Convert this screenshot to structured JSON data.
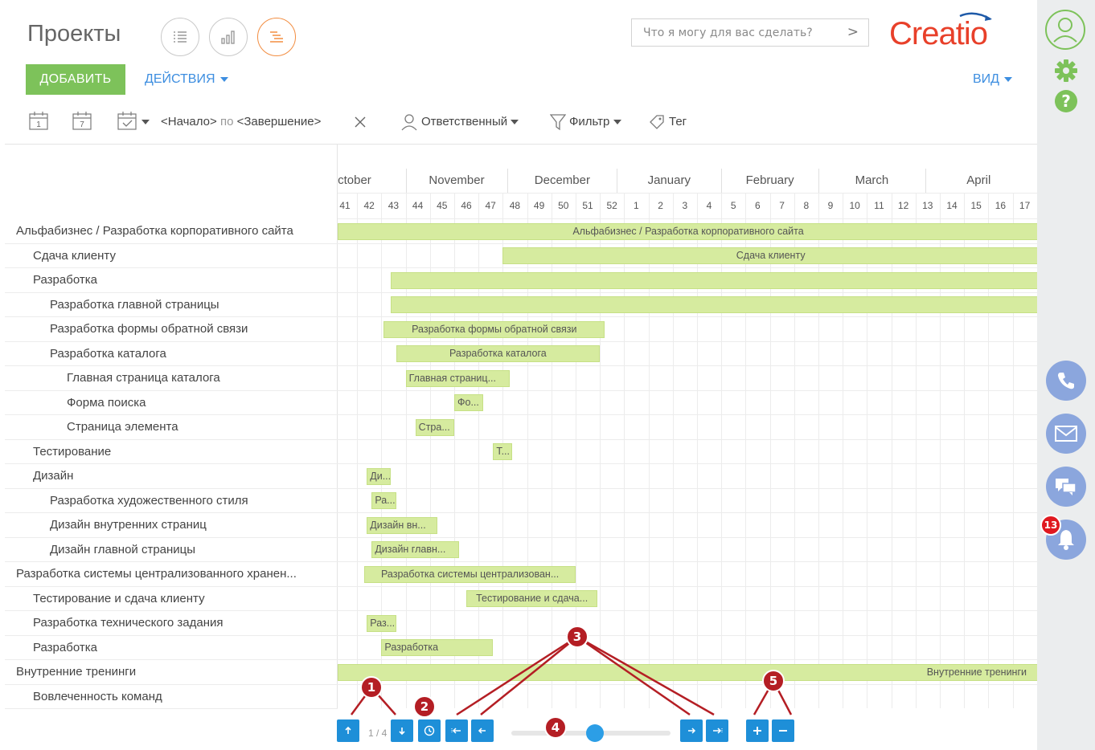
{
  "header": {
    "title": "Проекты",
    "search_placeholder": "Что я могу для вас сделать?",
    "logo": "Creatio",
    "add_label": "ДОБАВИТЬ",
    "actions_label": "ДЕЙСТВИЯ",
    "view_label": "ВИД",
    "view_modes": [
      "list-view-icon",
      "analytics-view-icon",
      "gantt-view-icon"
    ]
  },
  "filters": {
    "cal_day": "1",
    "cal_week": "7",
    "period": "<Начало> по <Завершение>",
    "period_start": "<Начало>",
    "period_sep": "по",
    "period_end": "<Завершение>",
    "owner": "Ответственный",
    "filter": "Фильтр",
    "tag": "Тег"
  },
  "timeline": {
    "months": [
      "October",
      "November",
      "December",
      "January",
      "February",
      "March",
      "April"
    ],
    "weeks": [
      "41",
      "42",
      "43",
      "44",
      "45",
      "46",
      "47",
      "48",
      "49",
      "50",
      "51",
      "52",
      "1",
      "2",
      "3",
      "4",
      "5",
      "6",
      "7",
      "8",
      "9",
      "10",
      "11",
      "12",
      "13",
      "14",
      "15",
      "16",
      "17"
    ]
  },
  "tasks": [
    {
      "name": "Альфабизнес / Разработка корпоративного сайта",
      "level": 0,
      "bar_label": "Альфабизнес / Разработка корпоративного сайта",
      "start_week": 0.0,
      "end_week": 30.0
    },
    {
      "name": "Сдача клиенту",
      "level": 1,
      "bar_label": "Сдача клиенту",
      "start_week": 7.0,
      "end_week": 30.0
    },
    {
      "name": "Разработка",
      "level": 1,
      "bar_label": "",
      "start_week": 2.4,
      "end_week": 30.0
    },
    {
      "name": "Разработка главной страницы",
      "level": 2,
      "bar_label": "",
      "start_week": 2.4,
      "end_week": 30.0
    },
    {
      "name": "Разработка формы обратной связи",
      "level": 2,
      "bar_label": "Разработка формы обратной связи",
      "start_week": 2.1,
      "end_week": 11.2
    },
    {
      "name": "Разработка каталога",
      "level": 2,
      "bar_label": "Разработка каталога",
      "start_week": 2.6,
      "end_week": 11.0
    },
    {
      "name": "Главная страница каталога",
      "level": 3,
      "bar_label": "Главная страниц...",
      "start_week": 3.0,
      "end_week": 7.3
    },
    {
      "name": "Форма поиска",
      "level": 3,
      "bar_label": "Фо...",
      "start_week": 5.0,
      "end_week": 6.2
    },
    {
      "name": "Страница элемента",
      "level": 3,
      "bar_label": "Стра...",
      "start_week": 3.4,
      "end_week": 5.0
    },
    {
      "name": "Тестирование",
      "level": 1,
      "bar_label": "Т...",
      "start_week": 6.6,
      "end_week": 7.4
    },
    {
      "name": "Дизайн",
      "level": 1,
      "bar_label": "Ди...",
      "start_week": 1.4,
      "end_week": 2.4
    },
    {
      "name": "Разработка художественного стиля",
      "level": 2,
      "bar_label": "Ра...",
      "start_week": 1.6,
      "end_week": 2.6
    },
    {
      "name": "Дизайн внутренних страниц",
      "level": 2,
      "bar_label": "Дизайн вн...",
      "start_week": 1.4,
      "end_week": 4.3
    },
    {
      "name": "Дизайн главной страницы",
      "level": 2,
      "bar_label": "Дизайн главн...",
      "start_week": 1.6,
      "end_week": 5.2
    },
    {
      "name": "Разработка системы централизованного хранен...",
      "level": 0,
      "bar_label": "Разработка системы централизован...",
      "start_week": 1.3,
      "end_week": 10.0
    },
    {
      "name": "Тестирование и сдача клиенту",
      "level": 1,
      "bar_label": "Тестирование и сдача...",
      "start_week": 5.5,
      "end_week": 10.9
    },
    {
      "name": "Разработка технического задания",
      "level": 1,
      "bar_label": "Раз...",
      "start_week": 1.4,
      "end_week": 2.6
    },
    {
      "name": "Разработка",
      "level": 1,
      "bar_label": "Разработка",
      "start_week": 2.0,
      "end_week": 6.6
    },
    {
      "name": "Внутренние тренинги",
      "level": 0,
      "bar_label": "Внутренние тренинги",
      "start_week": 0.0,
      "end_week": 30.0
    },
    {
      "name": "Вовлеченность команд",
      "level": 1,
      "bar_label": "",
      "start_week": null,
      "end_week": null
    }
  ],
  "controls": {
    "page_indicator": "1 / 4",
    "zoom_level": 0.5
  },
  "callouts": [
    "1",
    "2",
    "3",
    "4",
    "5"
  ],
  "notifications": {
    "count": "13"
  },
  "colors": {
    "accent": "#1e8fd8",
    "add_button": "#7dc25a",
    "bar_fill": "#d6eb9f",
    "callout": "#b41e24",
    "logo": "#e8402a"
  }
}
